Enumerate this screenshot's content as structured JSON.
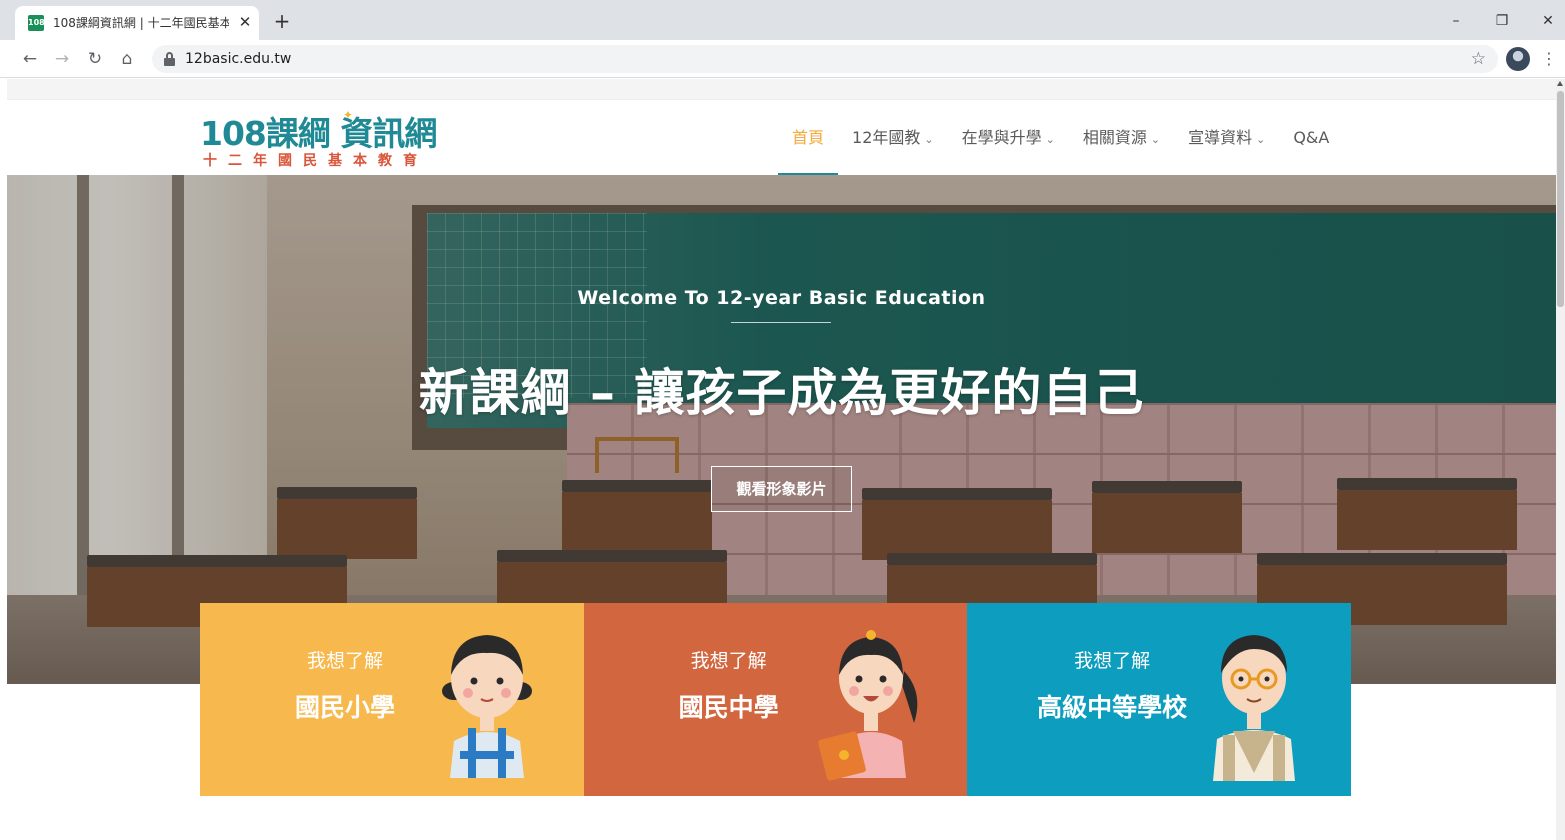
{
  "browser": {
    "tab_title": "108課綱資訊網 | 十二年國民基本",
    "tab_favicon": "108",
    "tab_close": "✕",
    "new_tab": "+",
    "url": "12basic.edu.tw",
    "icons": [
      "back-icon",
      "forward-icon",
      "reload-icon",
      "home-icon",
      "lock-icon",
      "star-icon",
      "avatar",
      "menu-icon"
    ]
  },
  "site": {
    "logo_main": "108課綱",
    "logo_highlight": "資訊網",
    "logo_sub": "十二年國民基本教育",
    "nav": [
      {
        "label": "首頁",
        "active": true,
        "dropdown": false
      },
      {
        "label": "12年國教",
        "active": false,
        "dropdown": true
      },
      {
        "label": "在學與升學",
        "active": false,
        "dropdown": true
      },
      {
        "label": "相關資源",
        "active": false,
        "dropdown": true
      },
      {
        "label": "宣導資料",
        "active": false,
        "dropdown": true
      },
      {
        "label": "Q&A",
        "active": false,
        "dropdown": false
      }
    ]
  },
  "hero": {
    "welcome": "Welcome To 12-year Basic Education",
    "title": "新課綱 – 讓孩子成為更好的自己",
    "button": "觀看形象影片"
  },
  "cards": [
    {
      "kicker": "我想了解",
      "title": "國民小學",
      "color": "#f7b84e",
      "illustration": "elementary-student-icon"
    },
    {
      "kicker": "我想了解",
      "title": "國民中學",
      "color": "#d2663f",
      "illustration": "junior-high-student-icon"
    },
    {
      "kicker": "我想了解",
      "title": "高級中等學校",
      "color": "#0d9dbe",
      "illustration": "high-school-teacher-icon"
    }
  ],
  "colors": {
    "brand_teal": "#1f8a95",
    "nav_active": "#f4a93c",
    "logo_sub_red": "#d9563a"
  }
}
